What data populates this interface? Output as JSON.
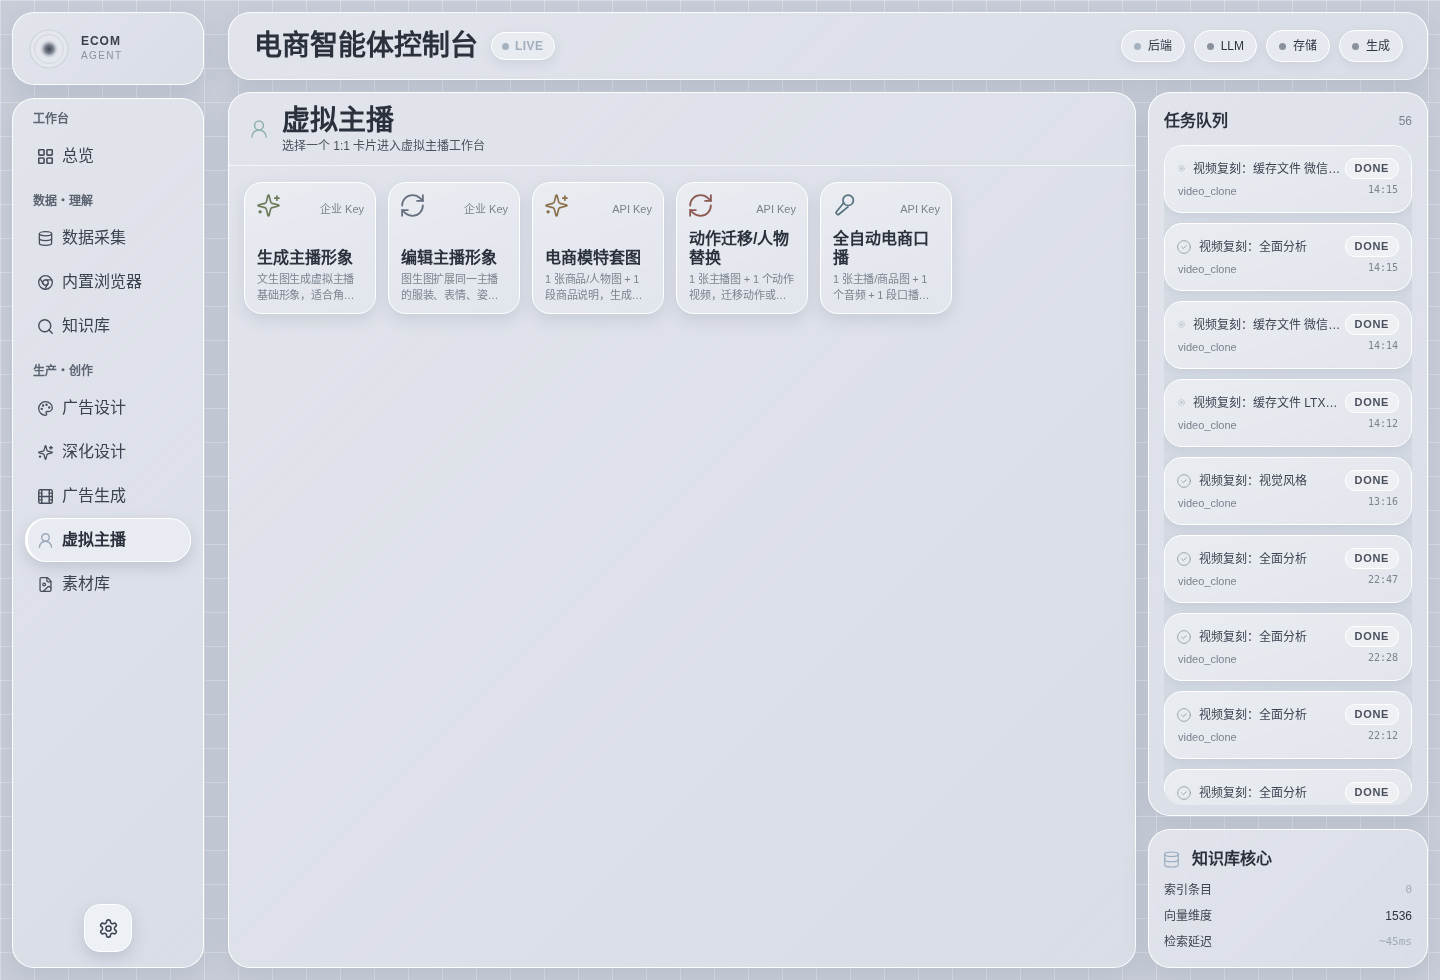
{
  "brand": {
    "name": "ECOM",
    "tagline": "AGENT"
  },
  "header": {
    "title": "电商智能体控制台",
    "live_badge": "LIVE",
    "services": [
      {
        "label": "后端",
        "color": "#a7b2c1"
      },
      {
        "label": "LLM",
        "color": "#89919c"
      },
      {
        "label": "存储",
        "color": "#89919c"
      },
      {
        "label": "生成",
        "color": "#89919c"
      }
    ]
  },
  "sidebar": {
    "sections": [
      {
        "label": "工作台",
        "items": [
          {
            "label": "总览",
            "selected": false
          }
        ]
      },
      {
        "label": "数据・理解",
        "items": [
          {
            "label": "数据采集",
            "selected": false
          },
          {
            "label": "内置浏览器",
            "selected": false
          },
          {
            "label": "知识库",
            "selected": false
          }
        ]
      },
      {
        "label": "生产・创作",
        "items": [
          {
            "label": "广告设计",
            "selected": false
          },
          {
            "label": "深化设计",
            "selected": false
          },
          {
            "label": "广告生成",
            "selected": false
          },
          {
            "label": "虚拟主播",
            "selected": true
          },
          {
            "label": "素材库",
            "selected": false
          }
        ]
      }
    ]
  },
  "page": {
    "title": "虚拟主播",
    "subtitle": "选择一个 1:1 卡片进入虚拟主播工作台",
    "cards": [
      {
        "title": "生成主播形象",
        "tag": "企业 Key",
        "description": "文生图生成虚拟主播基础形象，适合角…",
        "color": "#6c7a58"
      },
      {
        "title": "编辑主播形象",
        "tag": "企业 Key",
        "description": "图生图扩展同一主播的服装、表情、姿…",
        "color": "#687180"
      },
      {
        "title": "电商模特套图",
        "tag": "API Key",
        "description": "1 张商品/人物图 + 1 段商品说明，生成…",
        "color": "#8a7048"
      },
      {
        "title": "动作迁移/人物替换",
        "tag": "API Key",
        "description": "1 张主播图 + 1 个动作视频，迁移动作或…",
        "color": "#8c5a54"
      },
      {
        "title": "全自动电商口播",
        "tag": "API Key",
        "description": "1 张主播/商品图 + 1 个音频 + 1 段口播…",
        "color": "#56707e"
      }
    ]
  },
  "task_queue": {
    "title": "任务队列",
    "count": "56",
    "tasks": [
      {
        "kind": "cached",
        "title": "视频复刻：缓存文件 微信…",
        "status": "DONE",
        "type": "video_clone",
        "time": "14:15"
      },
      {
        "kind": "check",
        "title": "视频复刻：全面分析",
        "status": "DONE",
        "type": "video_clone",
        "time": "14:15"
      },
      {
        "kind": "cached",
        "title": "视频复刻：缓存文件 微信…",
        "status": "DONE",
        "type": "video_clone",
        "time": "14:14"
      },
      {
        "kind": "cached",
        "title": "视频复刻：缓存文件 LTX…",
        "status": "DONE",
        "type": "video_clone",
        "time": "14:12"
      },
      {
        "kind": "check",
        "title": "视频复刻：视觉风格",
        "status": "DONE",
        "type": "video_clone",
        "time": "13:16"
      },
      {
        "kind": "check",
        "title": "视频复刻：全面分析",
        "status": "DONE",
        "type": "video_clone",
        "time": "22:47"
      },
      {
        "kind": "check",
        "title": "视频复刻：全面分析",
        "status": "DONE",
        "type": "video_clone",
        "time": "22:28"
      },
      {
        "kind": "check",
        "title": "视频复刻：全面分析",
        "status": "DONE",
        "type": "video_clone",
        "time": "22:12"
      },
      {
        "kind": "check",
        "title": "视频复刻：全面分析",
        "status": "DONE"
      }
    ]
  },
  "knowledge_core": {
    "title": "知识库核心",
    "rows": [
      {
        "label": "索引条目",
        "value": "0",
        "muted": true
      },
      {
        "label": "向量维度",
        "value": "1536",
        "muted": false
      },
      {
        "label": "检索延迟",
        "value": "~45ms",
        "muted": true
      }
    ]
  }
}
